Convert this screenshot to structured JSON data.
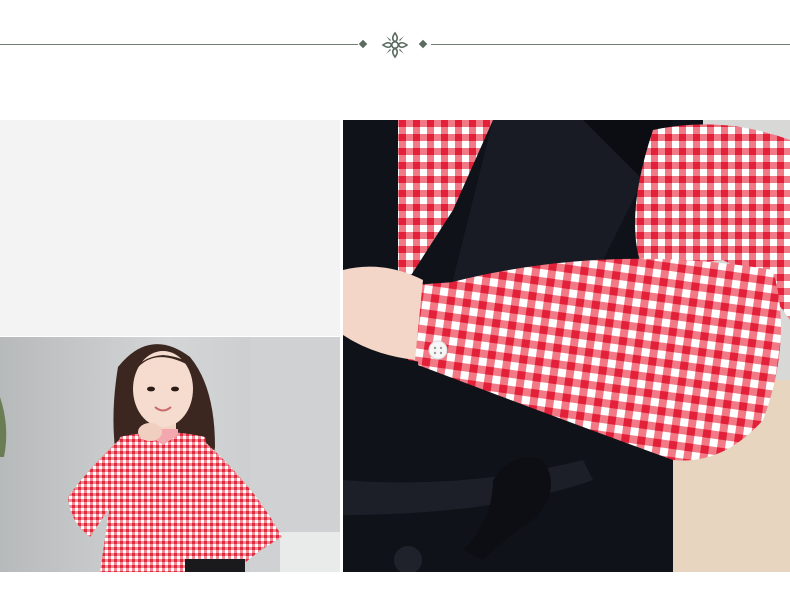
{
  "header": {
    "ornament_icon": "flower-ornament-icon",
    "line_color": "#6f7f74",
    "ornament_color": "#5a6b5f"
  },
  "images": {
    "model_photo": "model-in-red-gingham-blouse",
    "detail_photo": "red-gingham-sleeve-with-black-vest-detail"
  },
  "colors": {
    "gingham_red": "#e8263a",
    "vest_black": "#101219",
    "panel_gray": "#f3f3f3"
  }
}
